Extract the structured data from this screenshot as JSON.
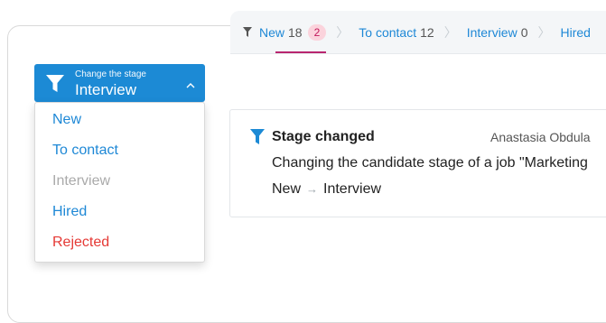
{
  "stages": [
    {
      "label": "New",
      "count": "18",
      "badge": "2",
      "active": true
    },
    {
      "label": "To contact",
      "count": "12"
    },
    {
      "label": "Interview",
      "count": "0"
    },
    {
      "label": "Hired"
    }
  ],
  "dropdown": {
    "caption": "Change the stage",
    "selected": "Interview",
    "options": [
      {
        "label": "New",
        "color": "#1e88d6"
      },
      {
        "label": "To contact",
        "color": "#1e88d6"
      },
      {
        "label": "Interview",
        "color": "#aaaaaa"
      },
      {
        "label": "Hired",
        "color": "#1e88d6"
      },
      {
        "label": "Rejected",
        "color": "#e53935"
      }
    ]
  },
  "card": {
    "title": "Stage changed",
    "author": "Anastasia Obdula",
    "description": "Changing the candidate stage of a job \"Marketing",
    "from": "New",
    "arrow": "→",
    "to": "Interview"
  },
  "colors": {
    "accent": "#1c8ad5",
    "badge_bg": "#fbd3dc",
    "danger": "#e53935",
    "muted": "#aaaaaa"
  }
}
